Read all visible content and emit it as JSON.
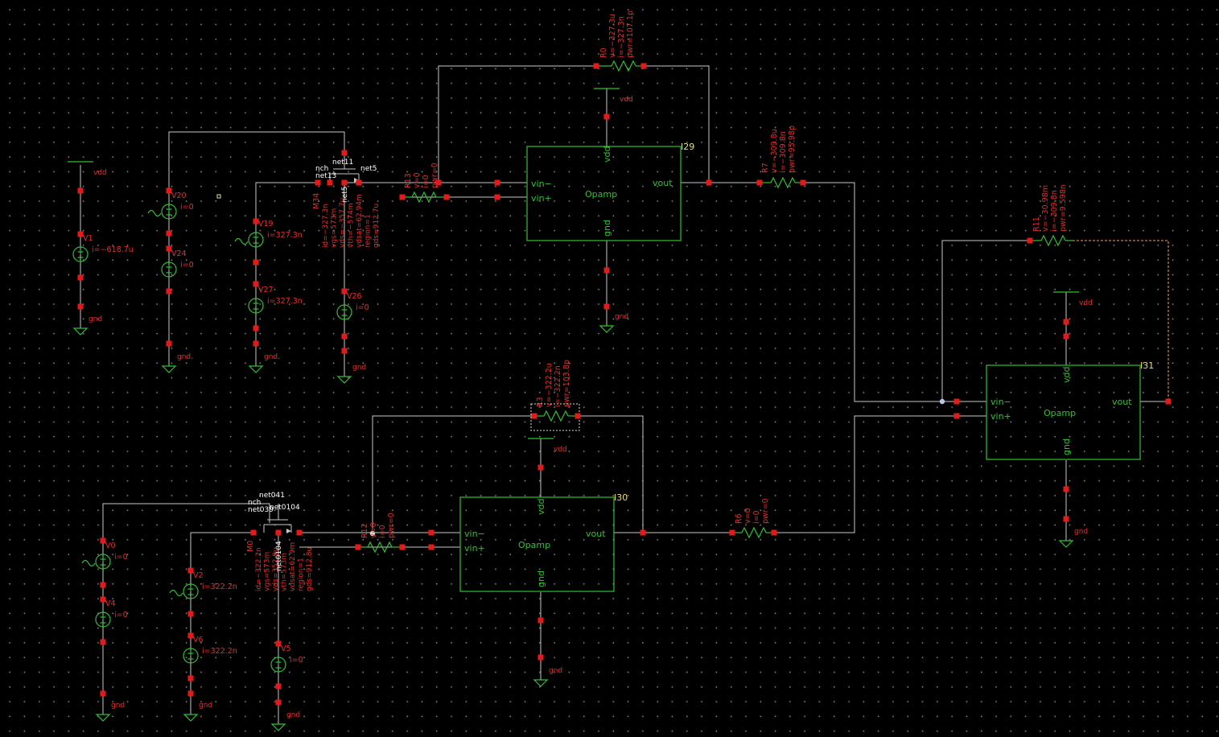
{
  "nets": {
    "vdd": "vdd",
    "gnd": "gnd",
    "gnd_dot": "gnd."
  },
  "opamps": [
    {
      "id": "I29",
      "label": "Opamp",
      "vin_minus": "vin−",
      "vin_plus": "vin+",
      "vout": "vout",
      "vdd": "vdd",
      "gnd": "gnd"
    },
    {
      "id": "I30",
      "label": "Opamp",
      "vin_minus": "vin−",
      "vin_plus": "vin+",
      "vout": "vout",
      "vdd": "vdd",
      "gnd": "gnd"
    },
    {
      "id": "I31",
      "label": "Opamp",
      "vin_minus": "vin−",
      "vin_plus": "vin+",
      "vout": "vout",
      "vdd": "vdd",
      "gnd": "gnd"
    }
  ],
  "resistors": {
    "R0": {
      "name": "R0",
      "v": "v=−327.3u",
      "i": "i=−327.3n",
      "pwr": "pwr=107.1p"
    },
    "R7": {
      "name": "R7",
      "v": "v=−309.8u",
      "i": "i=−309.8n",
      "pwr": "pwr=95.98p"
    },
    "R11": {
      "name": "R11",
      "v": "v=−30.98m",
      "i": "i=−309.8n",
      "pwr": "pwr=9.598n"
    },
    "R13": {
      "name": "R13",
      "v": "v=0",
      "i": "i=0",
      "pwr": "pwr=0"
    },
    "R3": {
      "name": "R3",
      "v": "v=−322.2u",
      "i": "i=−322.2n",
      "pwr": "pwr=103.8p"
    },
    "R12": {
      "name": "R12",
      "v": "v=0",
      "i": "i=0",
      "pwr": "pwr=0"
    },
    "R6": {
      "name": "R6",
      "v": "v=0",
      "i": "i=0",
      "pwr": "pwr=0"
    }
  },
  "sources": {
    "V1": {
      "name": "V1",
      "i": "i=−618.7u"
    },
    "V20": {
      "name": "V20",
      "i": "i=0"
    },
    "V24": {
      "name": "V24",
      "i": "i=0"
    },
    "V19": {
      "name": "V19",
      "i": "i=327.3n"
    },
    "V27": {
      "name": "V27",
      "i": "i=327.3n"
    },
    "V26": {
      "name": "V26",
      "i": "i=0"
    },
    "V0": {
      "name": "V0",
      "i": "i=0"
    },
    "V4": {
      "name": "V4",
      "i": "i=0"
    },
    "V2": {
      "name": "V2",
      "i": "i=322.2n"
    },
    "V6": {
      "name": "V6",
      "i": "i=322.2n"
    },
    "V5": {
      "name": "V5",
      "i": "i=0"
    }
  },
  "transistors": {
    "M34": {
      "type": "nch",
      "name": "M34",
      "net_d": "net13",
      "net_g": "net11",
      "net_s": "net5",
      "net_b": "net5",
      "params": [
        "id=−327.3n",
        "vgs=573m",
        "vds=−357.7u",
        "vth=−574m",
        "vdsat=62.94m",
        "region=1",
        "gds=912.7u"
      ]
    },
    "M0": {
      "type": "nch",
      "name": "M0",
      "net_d": "net039",
      "net_g": "net041",
      "net_s": "net0104",
      "net_b": "net0104",
      "params": [
        "id=−322.2n",
        "vgs=573m",
        "vds=352.9u",
        "vth=573m",
        "vdsat=62.9m",
        "region=1",
        "gds=912.8u"
      ]
    }
  }
}
